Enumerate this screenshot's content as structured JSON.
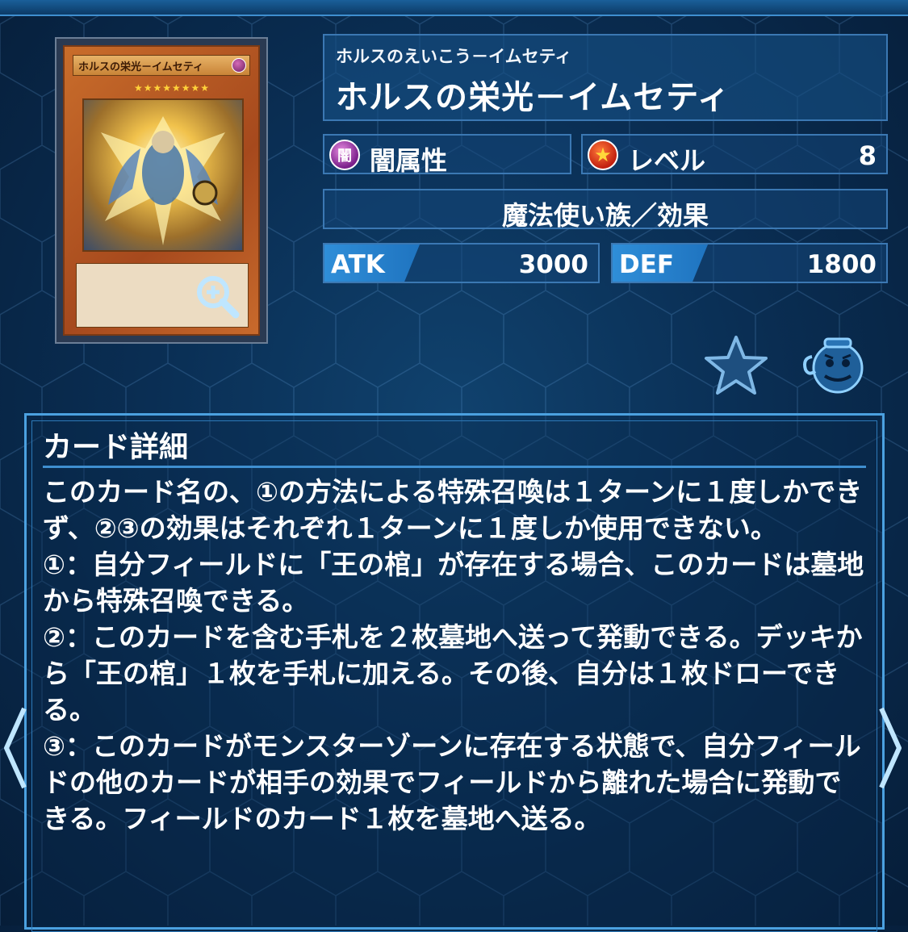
{
  "card": {
    "ruby": "ホルスのえいこう－イムセティ",
    "name": "ホルスの栄光－イムセティ",
    "mini_name": "ホルスの栄光－イムセティ",
    "mini_stars": "★★★★★★★★",
    "attribute_icon_glyph": "闇",
    "attribute": "闇属性",
    "level_label": "レベル",
    "level": "8",
    "race_type": "魔法使い族／効果",
    "atk_label": "ATK",
    "atk": "3000",
    "def_label": "DEF",
    "def": "1800"
  },
  "detail": {
    "title": "カード詳細",
    "text": "このカード名の、①の方法による特殊召喚は１ターンに１度しかできず、②③の効果はそれぞれ１ターンに１度しか使用できない。\n①：自分フィールドに「王の棺」が存在する場合、このカードは墓地から特殊召喚できる。\n②：このカードを含む手札を２枚墓地へ送って発動できる。デッキから「王の棺」１枚を手札に加える。その後、自分は１枚ドローできる。\n③：このカードがモンスターゾーンに存在する状態で、自分フィールドの他のカードが相手の効果でフィールドから離れた場合に発動できる。フィールドのカード１枚を墓地へ送る。"
  },
  "icons": [
    "zoom-icon",
    "favorite-star-icon",
    "pot-of-greed-icon",
    "chevron-left-icon",
    "chevron-right-icon"
  ],
  "colors": {
    "accent": "#4ba1e0",
    "background": "#0a2f55",
    "stat_tag": "#2f8ed8"
  }
}
